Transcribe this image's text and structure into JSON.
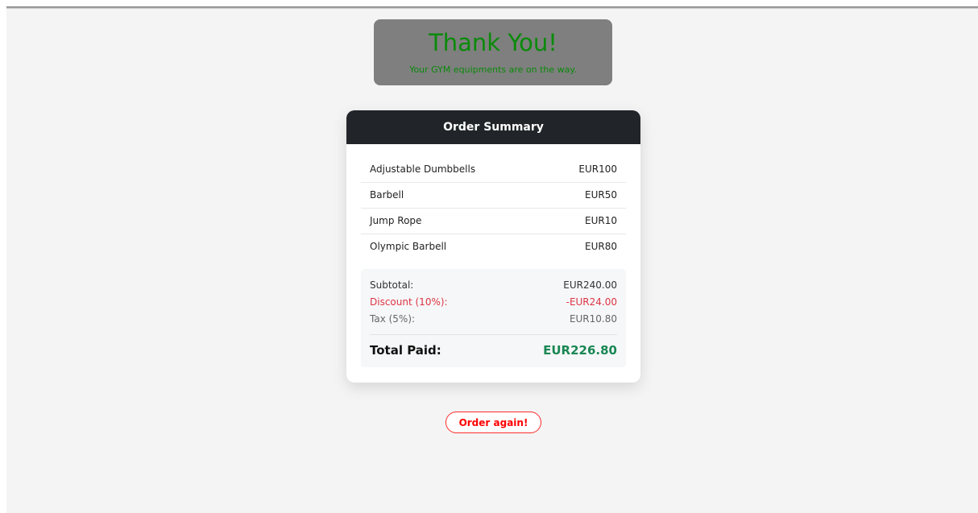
{
  "thank_you": {
    "title": "Thank You!",
    "subtitle": "Your GYM equipments are on the way."
  },
  "summary": {
    "header": "Order Summary",
    "items": [
      {
        "name": "Adjustable Dumbbells",
        "price": "EUR100"
      },
      {
        "name": "Barbell",
        "price": "EUR50"
      },
      {
        "name": "Jump Rope",
        "price": "EUR10"
      },
      {
        "name": "Olympic Barbell",
        "price": "EUR80"
      }
    ],
    "subtotal_label": "Subtotal:",
    "subtotal_value": "EUR240.00",
    "discount_label": "Discount (10%):",
    "discount_value": "-EUR24.00",
    "tax_label": "Tax (5%):",
    "tax_value": "EUR10.80",
    "total_label": "Total Paid:",
    "total_value": "EUR226.80"
  },
  "actions": {
    "order_again_label": "Order again!"
  },
  "colors": {
    "thank_text": "#0a8a0a",
    "thank_bg": "#7f7f7f",
    "header_bg": "#212529",
    "discount": "#dc3545",
    "total": "#198754",
    "button": "#ff0000"
  }
}
